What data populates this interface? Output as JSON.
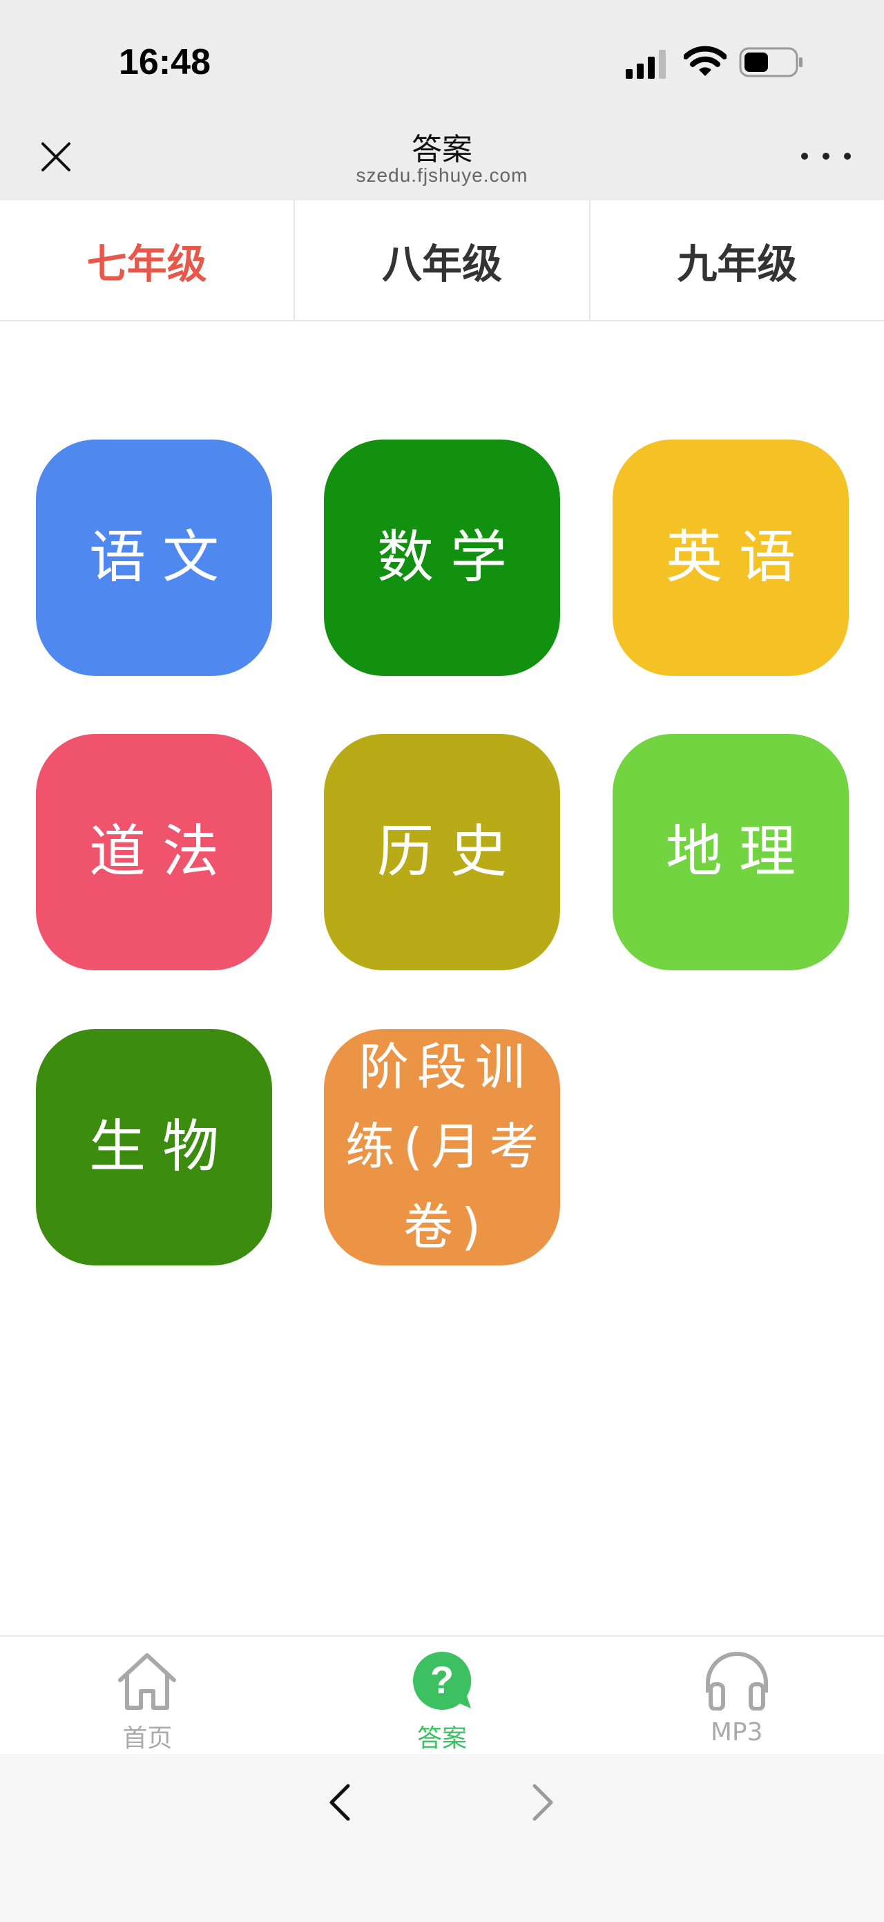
{
  "status": {
    "time": "16:48"
  },
  "header": {
    "title": "答案",
    "url": "szedu.fjshuye.com"
  },
  "tabs": [
    {
      "label": "七年级",
      "active": true
    },
    {
      "label": "八年级",
      "active": false
    },
    {
      "label": "九年级",
      "active": false
    }
  ],
  "subjects": [
    {
      "label": "语文",
      "color": "#4f89ef"
    },
    {
      "label": "数学",
      "color": "#12900f"
    },
    {
      "label": "英语",
      "color": "#f4c225"
    },
    {
      "label": "道法",
      "color": "#f0546c"
    },
    {
      "label": "历史",
      "color": "#b8ab17"
    },
    {
      "label": "地理",
      "color": "#72d441"
    },
    {
      "label": "生物",
      "color": "#3c8d0f"
    },
    {
      "label": "阶段训练(月考卷)",
      "color": "#ec9446"
    }
  ],
  "bottom_nav": [
    {
      "label": "首页",
      "icon": "home-icon",
      "active": false
    },
    {
      "label": "答案",
      "icon": "question-icon",
      "active": true
    },
    {
      "label": "MP3",
      "icon": "headphones-icon",
      "active": false
    }
  ],
  "colors": {
    "accent_red": "#e8584a",
    "accent_green": "#3cc062",
    "header_bg": "#ededed"
  }
}
